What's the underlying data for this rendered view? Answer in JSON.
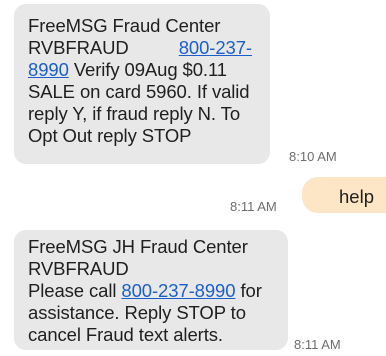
{
  "messages": [
    {
      "lines": [
        "FreeMSG Fraud Center",
        "RVBFRAUD",
        "800-237-",
        "8990",
        "Verify 09Aug $0.11",
        "SALE on card 5960. If valid",
        "reply Y, if fraud reply N. To",
        "Opt Out reply STOP"
      ],
      "time": "8:10 AM"
    },
    {
      "text": "help",
      "time": "8:11 AM"
    },
    {
      "lines": [
        "FreeMSG JH Fraud Center",
        "RVBFRAUD",
        "Please call",
        "800-237-8990",
        "for",
        "assistance. Reply STOP to",
        "cancel Fraud text alerts."
      ],
      "time": "8:11 AM"
    }
  ]
}
